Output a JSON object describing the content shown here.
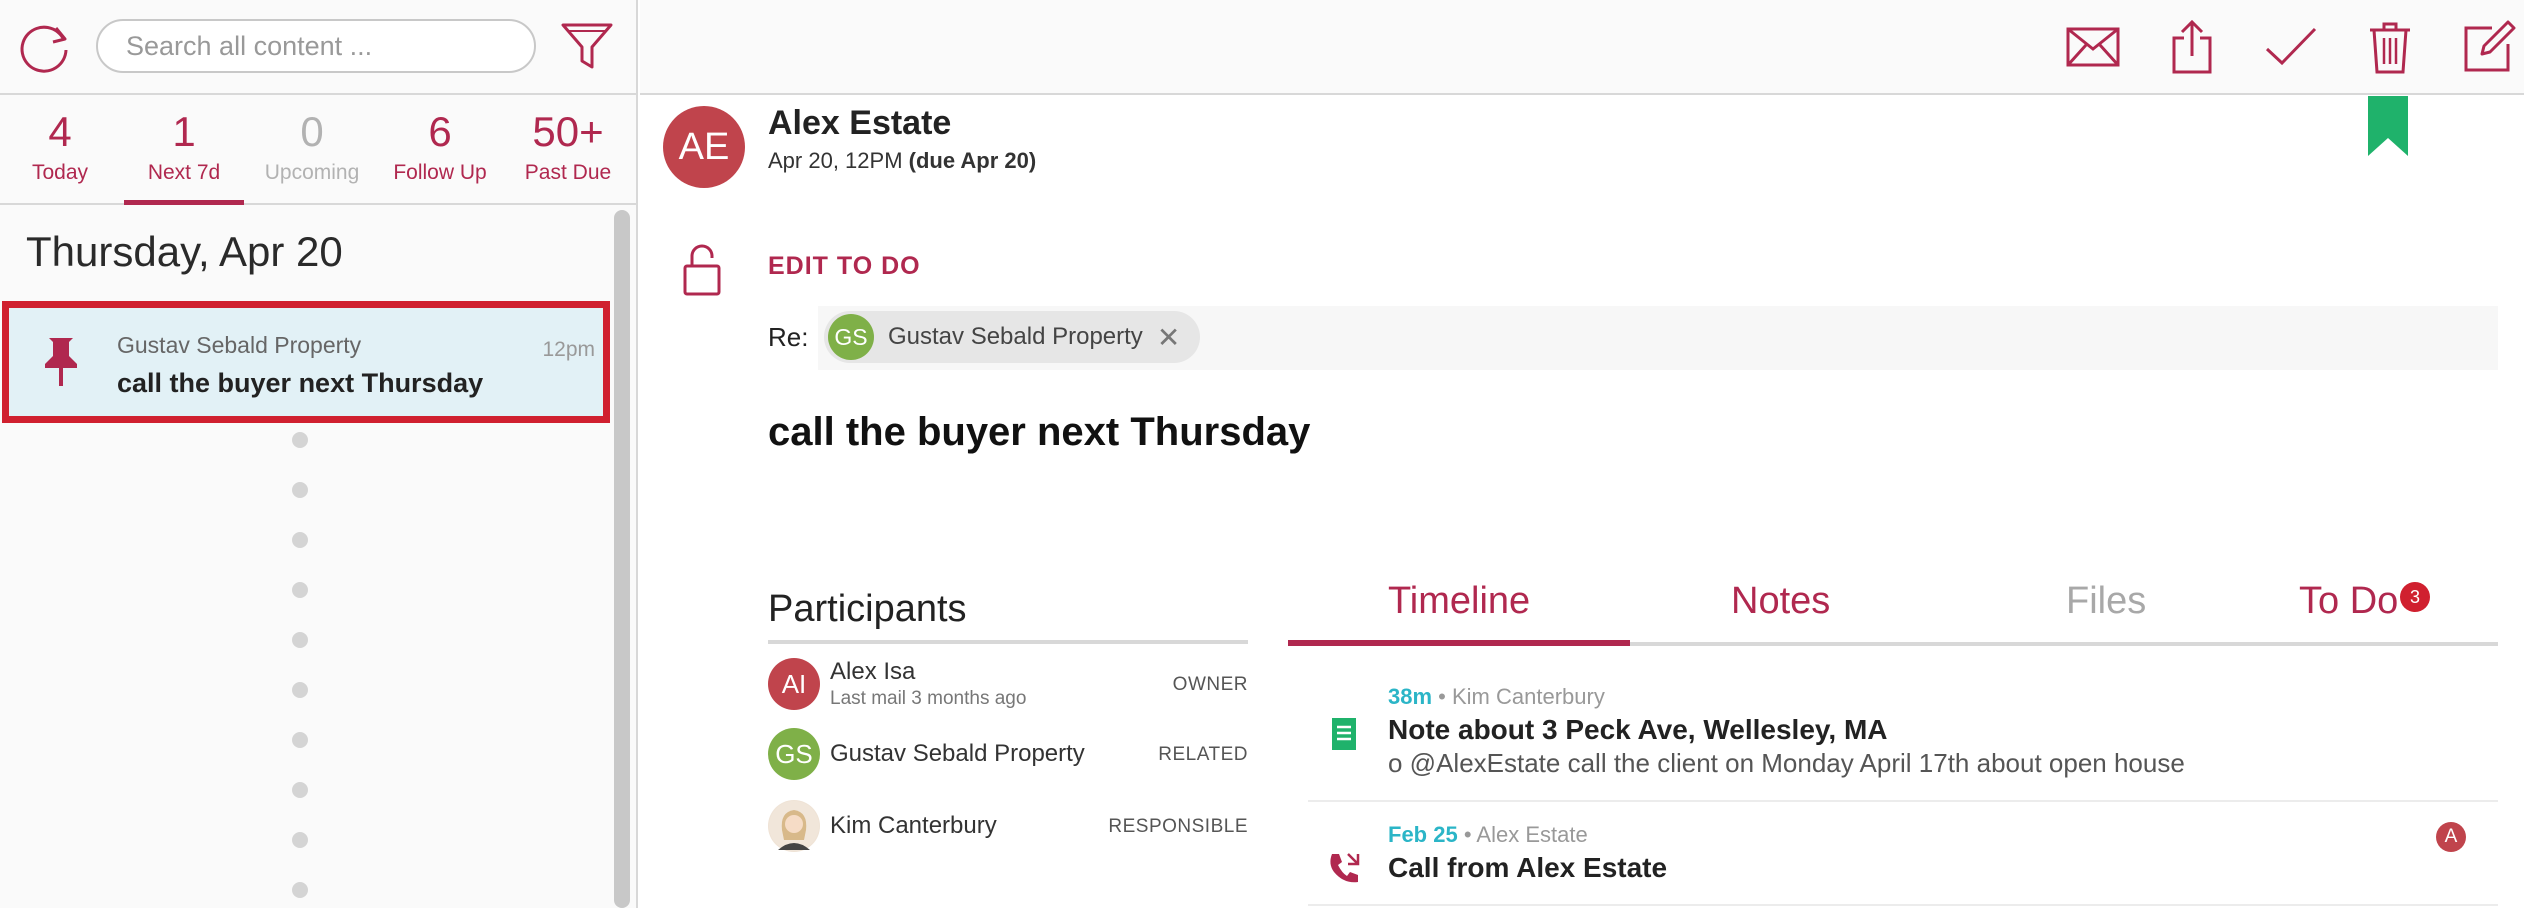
{
  "left": {
    "search": {
      "placeholder": "Search all content ..."
    },
    "tabs": [
      {
        "count": "4",
        "label": "Today"
      },
      {
        "count": "1",
        "label": "Next 7d"
      },
      {
        "count": "0",
        "label": "Upcoming"
      },
      {
        "count": "6",
        "label": "Follow Up"
      },
      {
        "count": "50+",
        "label": "Past Due"
      }
    ],
    "date_heading": "Thursday, Apr 20",
    "item": {
      "property": "Gustav Sebald Property",
      "title": "call the buyer next Thursday",
      "time": "12pm"
    }
  },
  "toolbar": {
    "icons": [
      "mail-icon",
      "share-icon",
      "checkmark-icon",
      "trash-icon",
      "edit-icon"
    ]
  },
  "detail": {
    "avatar_initials": "AE",
    "contact_name": "Alex Estate",
    "due_prefix": "Apr 20, 12PM",
    "due_bold": "(due Apr 20)",
    "edit_label": "EDIT TO DO",
    "re_label": "Re:",
    "re_chip": {
      "initials": "GS",
      "name": "Gustav Sebald Property",
      "remove": "✕"
    },
    "todo_title": "call the buyer next Thursday"
  },
  "participants": {
    "title": "Participants",
    "rows": [
      {
        "initials": "AI",
        "name": "Alex Isa",
        "sub": "Last mail 3 months ago",
        "role": "OWNER",
        "color": "#c0444c"
      },
      {
        "initials": "GS",
        "name": "Gustav Sebald Property",
        "sub": "",
        "role": "RELATED",
        "color": "#7fb048"
      },
      {
        "initials": "",
        "name": "Kim Canterbury",
        "sub": "",
        "role": "RESPONSIBLE",
        "color": "#e9d8c6"
      }
    ]
  },
  "detail_tabs": {
    "timeline": "Timeline",
    "notes": "Notes",
    "files": "Files",
    "todo": "To Do",
    "todo_badge": "3"
  },
  "timeline": [
    {
      "time": "38m",
      "author": "• Kim Canterbury",
      "heading": "Note about 3 Peck Ave, Wellesley, MA",
      "body": "o @AlexEstate call the client on Monday April 17th about open house",
      "icon": "note-icon"
    },
    {
      "time": "Feb 25",
      "author": "• Alex Estate",
      "heading": "Call from Alex Estate",
      "body": "",
      "icon": "phone-icon",
      "badge": "A"
    }
  ],
  "colors": {
    "accent": "#b0284f",
    "highlight_border": "#d0202f",
    "selected_bg": "#e2f1f6",
    "bookmark": "#1fb26b",
    "time_teal": "#2bb5c7"
  }
}
